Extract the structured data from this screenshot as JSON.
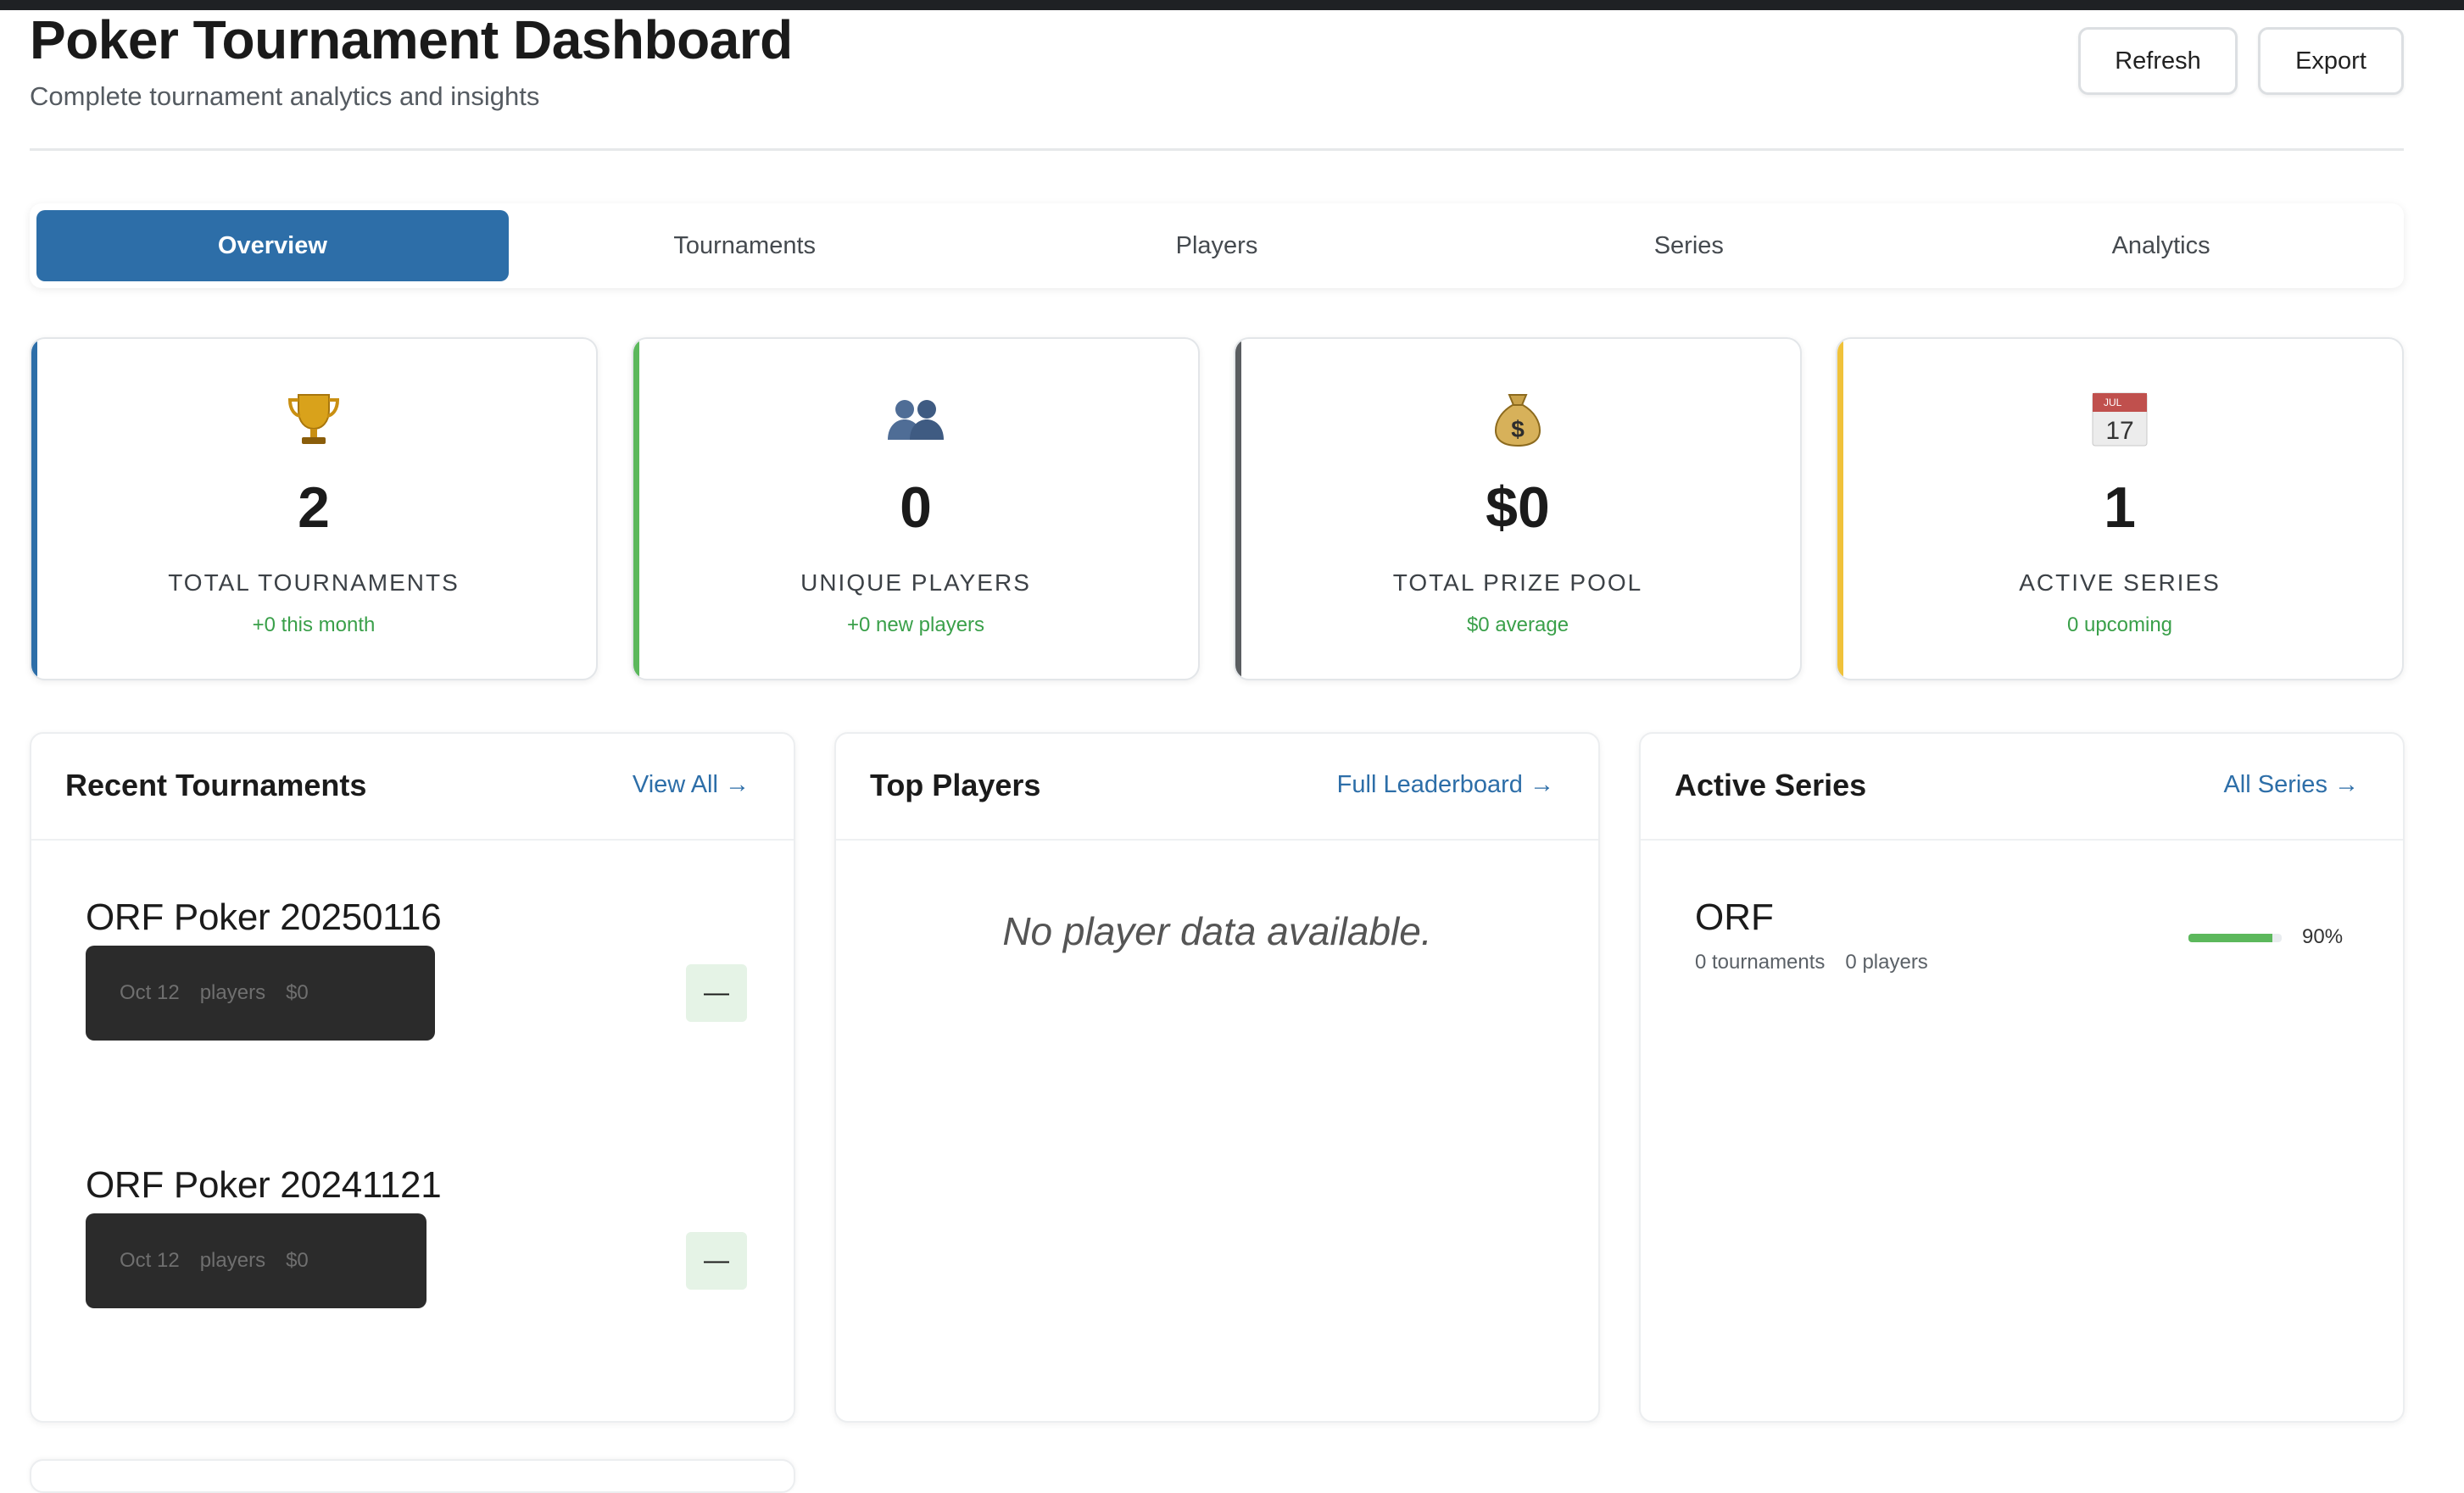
{
  "header": {
    "title": "Poker Tournament Dashboard",
    "subtitle": "Complete tournament analytics and insights",
    "refresh_label": "Refresh",
    "export_label": "Export"
  },
  "tabs": [
    {
      "label": "Overview",
      "active": true
    },
    {
      "label": "Tournaments",
      "active": false
    },
    {
      "label": "Players",
      "active": false
    },
    {
      "label": "Series",
      "active": false
    },
    {
      "label": "Analytics",
      "active": false
    }
  ],
  "stats": [
    {
      "icon": "trophy-icon",
      "value": "2",
      "label": "TOTAL TOURNAMENTS",
      "trend": "+0 this month",
      "accent": "#2d6ea8"
    },
    {
      "icon": "users-icon",
      "value": "0",
      "label": "UNIQUE PLAYERS",
      "trend": "+0 new players",
      "accent": "#5cb85c"
    },
    {
      "icon": "money-bag-icon",
      "value": "$0",
      "label": "TOTAL PRIZE POOL",
      "trend": "$0 average",
      "accent": "#5a5d60"
    },
    {
      "icon": "calendar-icon",
      "value": "1",
      "label": "ACTIVE SERIES",
      "trend": "0 upcoming",
      "accent": "#f0c23a",
      "calendar_month": "JUL",
      "calendar_day": "17"
    }
  ],
  "recent_tournaments": {
    "title": "Recent Tournaments",
    "link": "View All →",
    "items": [
      {
        "name": "ORF Poker 20250116",
        "date": "Oct 12",
        "players": "players",
        "prize": "$0",
        "status": "—"
      },
      {
        "name": "ORF Poker 20241121",
        "date": "Oct 12",
        "players": "players",
        "prize": "$0",
        "status": "—"
      }
    ]
  },
  "top_players": {
    "title": "Top Players",
    "link": "Full Leaderboard →",
    "empty": "No player data available."
  },
  "active_series": {
    "title": "Active Series",
    "link": "All Series →",
    "items": [
      {
        "name": "ORF",
        "tournaments": "0 tournaments",
        "players": "0 players",
        "progress_pct": "90%",
        "progress_value": 0.9
      }
    ]
  },
  "colors": {
    "primary": "#2d6ea8",
    "success": "#5cb85c",
    "warning": "#f0c23a",
    "dark": "#2b2b2b"
  }
}
